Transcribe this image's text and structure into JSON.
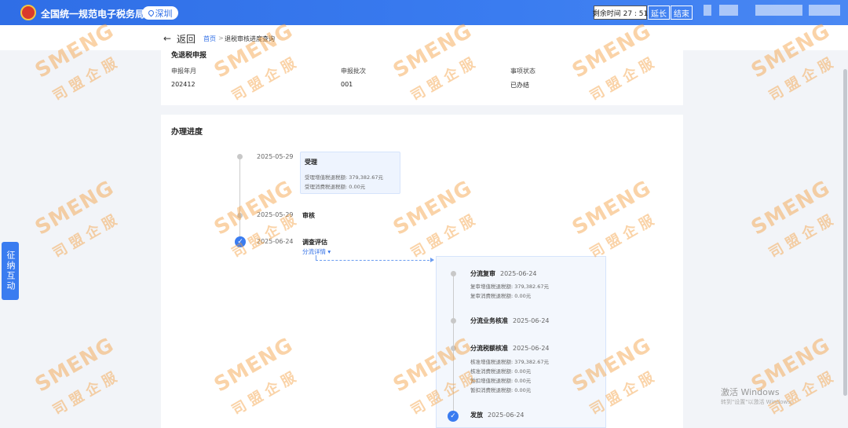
{
  "header": {
    "site_title": "全国统一规范电子税务局",
    "city": "深圳",
    "timer_label": "剩余时间 27 : 51",
    "extend_label": "延长",
    "end_label": "结束"
  },
  "nav": {
    "back_label": "返回",
    "breadcrumb_home": "首页",
    "breadcrumb_sep": ">",
    "breadcrumb_current": "退税审核进度查询"
  },
  "info": {
    "title": "免退税申报",
    "labels": [
      "申报年月",
      "申报批次",
      "事项状态"
    ],
    "values": [
      "202412",
      "001",
      "已办结"
    ]
  },
  "progress": {
    "title": "办理进度",
    "steps": [
      {
        "date": "2025-05-29",
        "name": "受理",
        "details": [
          "受理增值税退税额:  379,382.67元",
          "受理消费税退税额:  0.00元"
        ]
      },
      {
        "date": "2025-05-29",
        "name": "审核"
      },
      {
        "date": "2025-06-24",
        "name": "调查评估",
        "link": "分流详情"
      }
    ],
    "sub_steps": [
      {
        "name": "分流复审",
        "date": "2025-06-24",
        "details": [
          "复审增值税退税额:  379,382.67元",
          "复审消费税退税额:  0.00元"
        ]
      },
      {
        "name": "分流业务核准",
        "date": "2025-06-24"
      },
      {
        "name": "分流税额核准",
        "date": "2025-06-24",
        "details": [
          "核准增值税退税额:  379,382.67元",
          "核准消费税退税额:  0.00元",
          "暂扣增值税退税额:  0.00元",
          "暂扣消费税退税额:  0.00元"
        ]
      },
      {
        "name": "发放",
        "date": "2025-06-24"
      }
    ]
  },
  "side_tab": "征纳互动",
  "windows": {
    "activate": "激活 Windows",
    "hint": "转到\"设置\"以激活 Windows。"
  },
  "watermark": {
    "en": "SMENG",
    "cn": "司盟企服"
  },
  "colors": {
    "header_blue": "#2f6ee6",
    "accent_blue": "#3a7cf0",
    "watermark_orange": "#f5a040"
  }
}
